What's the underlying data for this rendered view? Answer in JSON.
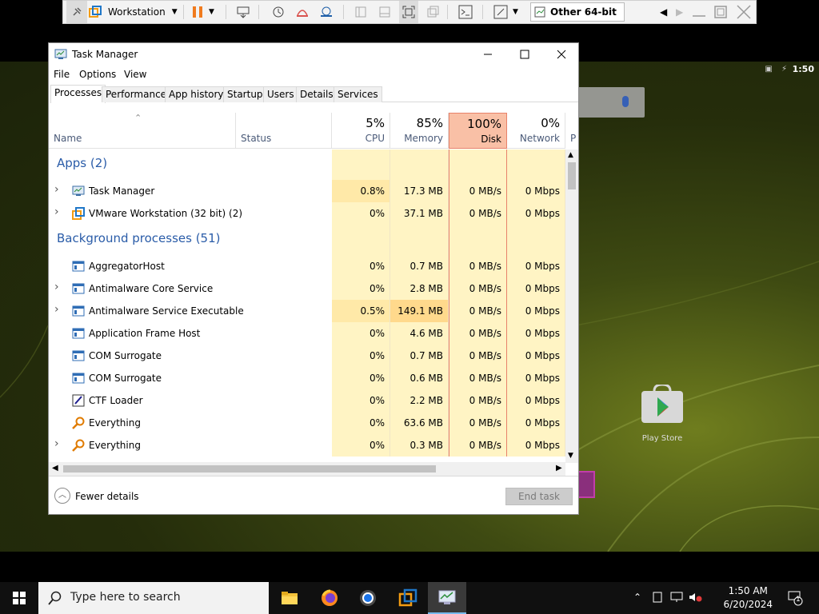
{
  "vmware": {
    "menu_label": "Workstation",
    "tab_label": "Other 64-bit"
  },
  "android": {
    "time": "1:50",
    "play_store_label": "Play Store"
  },
  "task_manager": {
    "title": "Task Manager",
    "menu": [
      "File",
      "Options",
      "View"
    ],
    "tabs": [
      "Processes",
      "Performance",
      "App history",
      "Startup",
      "Users",
      "Details",
      "Services"
    ],
    "active_tab": "Processes",
    "columns": {
      "name": "Name",
      "status": "Status",
      "cpu": {
        "pct": "5%",
        "label": "CPU"
      },
      "memory": {
        "pct": "85%",
        "label": "Memory"
      },
      "disk": {
        "pct": "100%",
        "label": "Disk"
      },
      "network": {
        "pct": "0%",
        "label": "Network"
      },
      "extra": "P"
    },
    "groups": {
      "apps": "Apps (2)",
      "background": "Background processes (51)"
    },
    "apps": [
      {
        "name": "Task Manager",
        "cpu": "0.8%",
        "memory": "17.3 MB",
        "disk": "0 MB/s",
        "network": "0 Mbps",
        "expandable": true,
        "icon": "taskmanager-icon"
      },
      {
        "name": "VMware Workstation (32 bit) (2)",
        "cpu": "0%",
        "memory": "37.1 MB",
        "disk": "0 MB/s",
        "network": "0 Mbps",
        "expandable": true,
        "icon": "vmware-icon"
      }
    ],
    "background": [
      {
        "name": "AggregatorHost",
        "cpu": "0%",
        "memory": "0.7 MB",
        "disk": "0 MB/s",
        "network": "0 Mbps",
        "expandable": false,
        "icon": "service-icon"
      },
      {
        "name": "Antimalware Core Service",
        "cpu": "0%",
        "memory": "2.8 MB",
        "disk": "0 MB/s",
        "network": "0 Mbps",
        "expandable": true,
        "icon": "service-icon"
      },
      {
        "name": "Antimalware Service Executable",
        "cpu": "0.5%",
        "memory": "149.1 MB",
        "disk": "0 MB/s",
        "network": "0 Mbps",
        "expandable": true,
        "icon": "service-icon"
      },
      {
        "name": "Application Frame Host",
        "cpu": "0%",
        "memory": "4.6 MB",
        "disk": "0 MB/s",
        "network": "0 Mbps",
        "expandable": false,
        "icon": "service-icon"
      },
      {
        "name": "COM Surrogate",
        "cpu": "0%",
        "memory": "0.7 MB",
        "disk": "0 MB/s",
        "network": "0 Mbps",
        "expandable": false,
        "icon": "service-icon"
      },
      {
        "name": "COM Surrogate",
        "cpu": "0%",
        "memory": "0.6 MB",
        "disk": "0 MB/s",
        "network": "0 Mbps",
        "expandable": false,
        "icon": "service-icon"
      },
      {
        "name": "CTF Loader",
        "cpu": "0%",
        "memory": "2.2 MB",
        "disk": "0 MB/s",
        "network": "0 Mbps",
        "expandable": false,
        "icon": "ctf-icon"
      },
      {
        "name": "Everything",
        "cpu": "0%",
        "memory": "63.6 MB",
        "disk": "0 MB/s",
        "network": "0 Mbps",
        "expandable": false,
        "icon": "everything-icon"
      },
      {
        "name": "Everything",
        "cpu": "0%",
        "memory": "0.3 MB",
        "disk": "0 MB/s",
        "network": "0 Mbps",
        "expandable": true,
        "icon": "everything-icon"
      }
    ],
    "fewer_details": "Fewer details",
    "end_task": "End task"
  },
  "taskbar": {
    "search_placeholder": "Type here to search",
    "time": "1:50 AM",
    "date": "6/20/2024",
    "notification_count": "1"
  },
  "colors": {
    "heat_light": "#fff4c4",
    "heat_mid": "#ffe9a8",
    "heat_strong": "#ffd98c",
    "disk_header": "#f9c0a6",
    "group_blue": "#2a5ca8"
  }
}
